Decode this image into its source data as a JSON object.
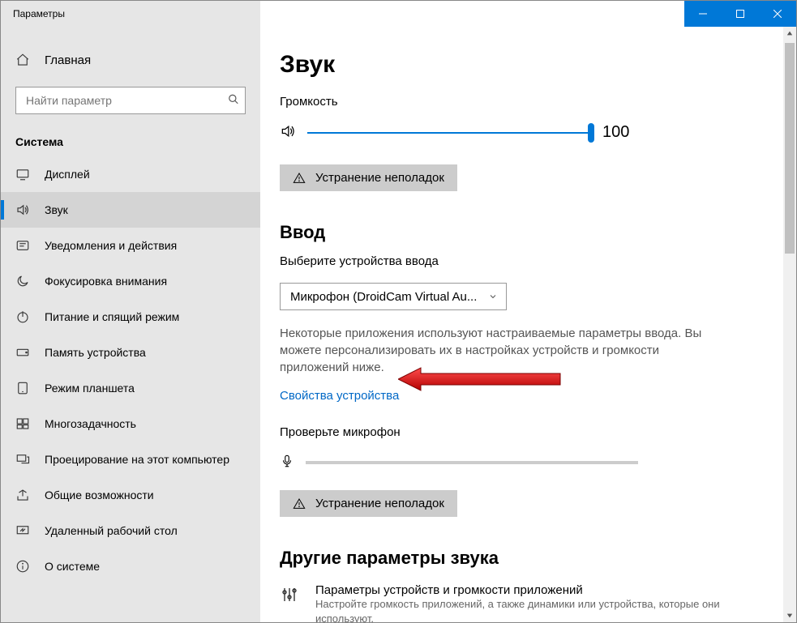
{
  "window": {
    "title": "Параметры"
  },
  "sidebar": {
    "home": "Главная",
    "search_placeholder": "Найти параметр",
    "category": "Система",
    "items": [
      {
        "label": "Дисплей"
      },
      {
        "label": "Звук"
      },
      {
        "label": "Уведомления и действия"
      },
      {
        "label": "Фокусировка внимания"
      },
      {
        "label": "Питание и спящий режим"
      },
      {
        "label": "Память устройства"
      },
      {
        "label": "Режим планшета"
      },
      {
        "label": "Многозадачность"
      },
      {
        "label": "Проецирование на этот компьютер"
      },
      {
        "label": "Общие возможности"
      },
      {
        "label": "Удаленный рабочий стол"
      },
      {
        "label": "О системе"
      }
    ]
  },
  "main": {
    "title": "Звук",
    "volume_label": "Громкость",
    "volume_value": "100",
    "troubleshoot": "Устранение неполадок",
    "input_section": {
      "title": "Ввод",
      "choose_label": "Выберите устройства ввода",
      "device": "Микрофон (DroidCam Virtual Au...",
      "description": "Некоторые приложения используют настраиваемые параметры ввода. Вы можете персонализировать их в настройках устройств и громкости приложений ниже.",
      "properties_link": "Свойства устройства",
      "test_label": "Проверьте микрофон",
      "troubleshoot": "Устранение неполадок"
    },
    "other_section": {
      "title": "Другие параметры звука",
      "item_title": "Параметры устройств и громкости приложений",
      "item_desc": "Настройте громкость приложений, а также динамики или устройства, которые они используют."
    }
  }
}
